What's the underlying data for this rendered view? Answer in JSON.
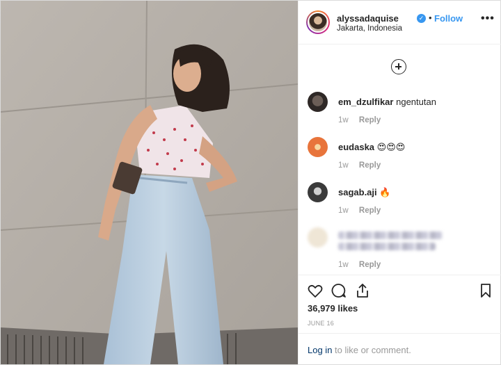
{
  "post": {
    "username": "alyssadaquise",
    "verified_icon": "verified-badge-icon",
    "separator": "•",
    "follow_label": "Follow",
    "location": "Jakarta, Indonesia",
    "more_label": "•••"
  },
  "comments": [
    {
      "user": "em_dzulfikar",
      "text": "ngentutan",
      "time": "1w",
      "reply": "Reply"
    },
    {
      "user": "eudaska",
      "text": "😍😍😍",
      "time": "1w",
      "reply": "Reply"
    },
    {
      "user": "sagab.aji",
      "text": "🔥",
      "time": "1w",
      "reply": "Reply"
    },
    {
      "user": "",
      "text": "",
      "time": "1w",
      "reply": "Reply"
    }
  ],
  "actions": {
    "likes": "36,979 likes",
    "date": "JUNE 16",
    "login_link": "Log in",
    "login_rest": "to like or comment."
  },
  "colors": {
    "accent": "#3897f0",
    "link_dark": "#003569",
    "muted": "#999999"
  }
}
